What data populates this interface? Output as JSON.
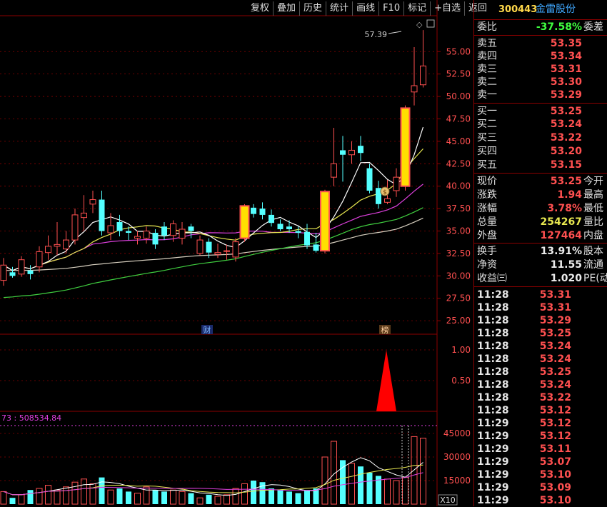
{
  "toolbar": [
    "复权",
    "叠加",
    "历史",
    "统计",
    "画线",
    "F10",
    "标记",
    "+自选",
    "返回"
  ],
  "stock": {
    "code": "300443",
    "name": "金雷股份"
  },
  "colors": {
    "up": "#ff5050",
    "down": "#54ffff",
    "ma5": "#ffffff",
    "ma10": "#e8e850",
    "ma20": "#e040e0",
    "ma60": "#40d040",
    "ma120": "#d8d0c0",
    "markbar": "#ffe000"
  },
  "quote": {
    "weibi": {
      "label": "委比",
      "value": "-37.58%",
      "label2": "委差"
    },
    "sell": [
      {
        "label": "卖五",
        "price": "53.35"
      },
      {
        "label": "卖四",
        "price": "53.34"
      },
      {
        "label": "卖三",
        "price": "53.31"
      },
      {
        "label": "卖二",
        "price": "53.30"
      },
      {
        "label": "卖一",
        "price": "53.29"
      }
    ],
    "buy": [
      {
        "label": "买一",
        "price": "53.25"
      },
      {
        "label": "买二",
        "price": "53.24"
      },
      {
        "label": "买三",
        "price": "53.22"
      },
      {
        "label": "买四",
        "price": "53.20"
      },
      {
        "label": "买五",
        "price": "53.15"
      }
    ],
    "stats1": [
      {
        "label": "现价",
        "value": "53.25",
        "label2": "今开"
      },
      {
        "label": "涨跌",
        "value": "1.94",
        "label2": "最高"
      },
      {
        "label": "涨幅",
        "value": "3.78%",
        "label2": "最低"
      },
      {
        "label": "总量",
        "value": "254267",
        "label2": "量比"
      },
      {
        "label": "外盘",
        "value": "127464",
        "label2": "内盘"
      }
    ],
    "stats2": [
      {
        "label": "换手",
        "value": "13.91%",
        "label2": "股本"
      },
      {
        "label": "净资",
        "value": "11.55",
        "label2": "流通"
      },
      {
        "label": "收益㈢",
        "value": "1.020",
        "label2": "PE(动)"
      }
    ]
  },
  "ticks": [
    {
      "time": "11:28",
      "price": "53.31"
    },
    {
      "time": "11:28",
      "price": "53.31"
    },
    {
      "time": "11:28",
      "price": "53.29"
    },
    {
      "time": "11:28",
      "price": "53.25"
    },
    {
      "time": "11:28",
      "price": "53.24"
    },
    {
      "time": "11:28",
      "price": "53.24"
    },
    {
      "time": "11:28",
      "price": "53.25"
    },
    {
      "time": "11:28",
      "price": "53.24"
    },
    {
      "time": "11:28",
      "price": "53.22"
    },
    {
      "time": "11:28",
      "price": "53.12"
    },
    {
      "time": "11:29",
      "price": "53.12"
    },
    {
      "time": "11:29",
      "price": "53.12"
    },
    {
      "time": "11:29",
      "price": "53.11"
    },
    {
      "time": "11:29",
      "price": "53.07"
    },
    {
      "time": "11:29",
      "price": "53.10"
    },
    {
      "time": "11:29",
      "price": "53.09"
    },
    {
      "time": "11:29",
      "price": "53.10"
    }
  ],
  "chart_data": {
    "type": "candlestick",
    "price_axis": {
      "ticks": [
        "55.00",
        "52.50",
        "50.00",
        "47.50",
        "45.00",
        "42.50",
        "40.00",
        "37.50",
        "35.00",
        "32.50",
        "30.00",
        "27.50",
        "25.00"
      ],
      "range": [
        23.5,
        59.0
      ]
    },
    "high_label": "57.39",
    "markers": [
      {
        "text": "财",
        "index": 20
      },
      {
        "text": "榜",
        "index": 38
      }
    ],
    "indicator": {
      "ticks": [
        "1.00",
        "0.50"
      ],
      "peak": 1.0
    },
    "volume": {
      "header": "73 : 508534.84",
      "ticks": [
        "45000",
        "30000",
        "15000"
      ],
      "unit_label": "X10"
    },
    "candles": [
      [
        29.5,
        31.2,
        28.9,
        32.0
      ],
      [
        30.4,
        30.0,
        29.8,
        31.0
      ],
      [
        30.2,
        31.8,
        29.9,
        32.2
      ],
      [
        30.6,
        30.2,
        29.6,
        31.2
      ],
      [
        31.0,
        32.7,
        30.4,
        33.3
      ],
      [
        32.6,
        33.3,
        31.8,
        34.5
      ],
      [
        33.3,
        33.5,
        32.3,
        36.0
      ],
      [
        33.0,
        34.0,
        32.5,
        35.0
      ],
      [
        34.0,
        36.8,
        33.5,
        37.5
      ],
      [
        36.5,
        37.0,
        35.0,
        39.0
      ],
      [
        38.0,
        38.5,
        37.0,
        39.5
      ],
      [
        38.5,
        35.0,
        34.5,
        39.5
      ],
      [
        34.8,
        35.6,
        34.0,
        37.0
      ],
      [
        36.0,
        35.0,
        34.4,
        36.8
      ],
      [
        35.0,
        34.8,
        34.0,
        35.5
      ],
      [
        34.2,
        34.4,
        33.5,
        35.0
      ],
      [
        34.2,
        35.0,
        33.6,
        35.5
      ],
      [
        34.8,
        33.5,
        33.0,
        35.2
      ],
      [
        35.5,
        34.5,
        34.0,
        36.0
      ],
      [
        34.5,
        35.8,
        33.8,
        36.2
      ],
      [
        34.2,
        35.2,
        33.5,
        36.0
      ],
      [
        35.5,
        35.0,
        34.2,
        35.8
      ],
      [
        32.5,
        34.0,
        32.3,
        34.5
      ],
      [
        33.8,
        32.6,
        32.0,
        34.2
      ],
      [
        32.4,
        32.6,
        32.0,
        33.6
      ],
      [
        32.8,
        32.8,
        31.8,
        33.5
      ],
      [
        32.1,
        33.8,
        31.6,
        34.2
      ],
      [
        34.2,
        37.8,
        33.8,
        38.0
      ],
      [
        37.6,
        36.9,
        36.5,
        38.0
      ],
      [
        37.5,
        36.8,
        36.3,
        38.2
      ],
      [
        36.8,
        35.9,
        35.5,
        37.4
      ],
      [
        35.8,
        35.2,
        35.0,
        36.3
      ],
      [
        35.5,
        35.2,
        34.8,
        36.2
      ],
      [
        35.0,
        34.8,
        34.2,
        35.5
      ],
      [
        34.9,
        33.4,
        33.0,
        35.8
      ],
      [
        33.5,
        32.8,
        32.6,
        34.8
      ],
      [
        32.8,
        39.4,
        32.5,
        39.6
      ],
      [
        41.0,
        42.5,
        40.0,
        46.5
      ],
      [
        44.0,
        43.5,
        40.5,
        45.6
      ],
      [
        43.5,
        44.0,
        42.5,
        45.0
      ],
      [
        44.5,
        43.7,
        42.8,
        45.6
      ],
      [
        42.0,
        39.5,
        39.2,
        42.5
      ],
      [
        39.8,
        38.0,
        37.5,
        40.6
      ],
      [
        38.2,
        38.6,
        38.0,
        40.7
      ],
      [
        39.5,
        41.0,
        38.8,
        42.0
      ],
      [
        40.0,
        48.7,
        39.5,
        49.0
      ],
      [
        50.5,
        51.2,
        49.0,
        55.5
      ],
      [
        51.3,
        53.4,
        51.0,
        57.4
      ]
    ],
    "volumes": [
      8,
      4,
      6,
      9,
      10,
      12,
      9,
      11,
      14,
      16,
      13,
      17,
      9,
      10,
      8,
      7,
      11,
      9,
      8,
      9,
      8,
      7,
      4,
      6,
      5,
      6,
      10,
      13,
      15,
      14,
      10,
      9,
      8,
      7,
      9,
      10,
      30,
      40,
      28,
      26,
      24,
      20,
      18,
      16,
      15,
      17,
      43,
      42
    ]
  }
}
